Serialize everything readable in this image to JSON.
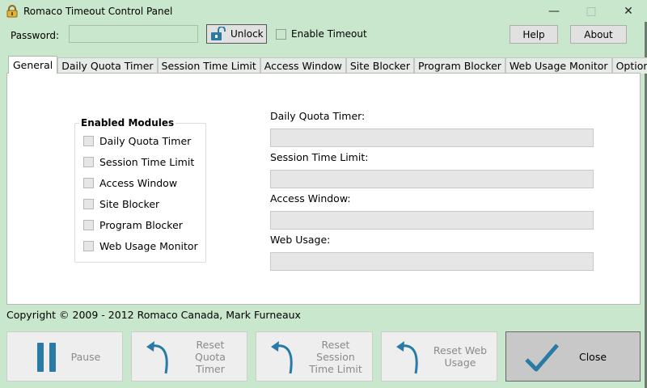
{
  "window": {
    "title": "Romaco Timeout Control Panel",
    "min_icon": "minimize-icon",
    "max_icon": "maximize-icon",
    "close_icon": "close-icon"
  },
  "toolbar": {
    "password_label": "Password:",
    "password_value": "",
    "unlock_label": "Unlock",
    "enable_timeout_label": "Enable Timeout",
    "enable_timeout_checked": false,
    "help_label": "Help",
    "about_label": "About"
  },
  "tabs": [
    {
      "label": "General",
      "active": true
    },
    {
      "label": "Daily Quota Timer",
      "active": false
    },
    {
      "label": "Session Time Limit",
      "active": false
    },
    {
      "label": "Access Window",
      "active": false
    },
    {
      "label": "Site Blocker",
      "active": false
    },
    {
      "label": "Program Blocker",
      "active": false
    },
    {
      "label": "Web Usage Monitor",
      "active": false
    },
    {
      "label": "Options",
      "active": false
    }
  ],
  "general": {
    "group_title": "Enabled Modules",
    "modules": [
      {
        "label": "Daily Quota Timer",
        "checked": false
      },
      {
        "label": "Session Time Limit",
        "checked": false
      },
      {
        "label": "Access Window",
        "checked": false
      },
      {
        "label": "Site Blocker",
        "checked": false
      },
      {
        "label": "Program Blocker",
        "checked": false
      },
      {
        "label": "Web Usage Monitor",
        "checked": false
      }
    ],
    "fields": [
      {
        "label": "Daily Quota Timer:",
        "value": ""
      },
      {
        "label": "Session Time Limit:",
        "value": ""
      },
      {
        "label": "Access Window:",
        "value": ""
      },
      {
        "label": "Web Usage:",
        "value": ""
      }
    ]
  },
  "footer": {
    "copyright": "Copyright © 2009 - 2012 Romaco Canada, Mark Furneaux",
    "buttons": [
      {
        "label": "Pause",
        "icon": "pause-icon"
      },
      {
        "label_lines": [
          "Reset",
          "Quota",
          "Timer"
        ],
        "icon": "reset-arrow-icon"
      },
      {
        "label_lines": [
          "Reset",
          "Session",
          "Time Limit"
        ],
        "icon": "reset-arrow-icon"
      },
      {
        "label_lines": [
          "Reset Web",
          "Usage"
        ],
        "icon": "reset-arrow-icon"
      },
      {
        "label": "Close",
        "icon": "checkmark-icon"
      }
    ]
  },
  "colors": {
    "window_bg": "#c9e7cc",
    "panel_bg": "#ffffff",
    "icon_teal": "#2a7aa6"
  }
}
